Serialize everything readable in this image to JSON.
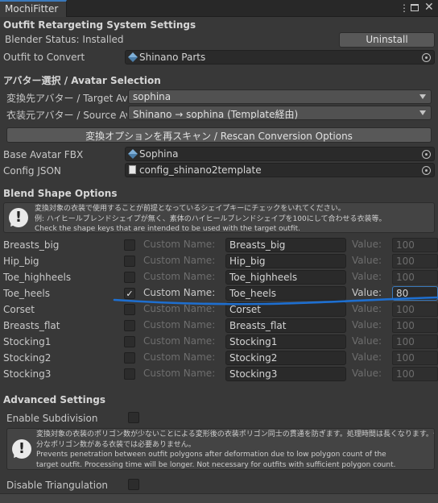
{
  "window": {
    "tab_title": "MochiFitter",
    "menu_icon": "kebab-menu-icon",
    "maximize_icon": "maximize-icon",
    "close_icon": "close-icon"
  },
  "retargeting": {
    "title": "Outfit Retargeting System Settings",
    "blender_status": "Blender Status: Installed",
    "uninstall_label": "Uninstall",
    "outfit_label": "Outfit to Convert",
    "outfit_value": "Shinano Parts"
  },
  "avatar": {
    "title": "アバター選択 / Avatar Selection",
    "target_label": "変換先アバター / Target Avat",
    "target_value": "sophina",
    "source_label": "衣装元アバター / Source Ava",
    "source_value": "Shinano → sophina (Template経由)",
    "rescan_label": "変換オプションを再スキャン / Rescan Conversion Options",
    "base_fbx_label": "Base Avatar FBX",
    "base_fbx_value": "Sophina",
    "config_label": "Config JSON",
    "config_value": "config_shinano2template"
  },
  "blend": {
    "title": "Blend Shape Options",
    "help_lines": [
      "変換対象の衣装で使用することが前提となっているシェイプキーにチェックをいれてください。",
      "例: ハイヒールブレンドシェイプが無く、素体のハイヒールブレンドシェイプを100にして合わせる衣装等。",
      "Check the shape keys that are intended to be used with the target outfit."
    ],
    "custom_name_label": "Custom Name:",
    "value_label": "Value:",
    "rows": [
      {
        "name": "Breasts_big",
        "checked": false,
        "custom": "Breasts_big",
        "value": "100"
      },
      {
        "name": "Hip_big",
        "checked": false,
        "custom": "Hip_big",
        "value": "100"
      },
      {
        "name": "Toe_highheels",
        "checked": false,
        "custom": "Toe_highheels",
        "value": "100"
      },
      {
        "name": "Toe_heels",
        "checked": true,
        "custom": "Toe_heels",
        "value": "80"
      },
      {
        "name": "Corset",
        "checked": false,
        "custom": "Corset",
        "value": "100"
      },
      {
        "name": "Breasts_flat",
        "checked": false,
        "custom": "Breasts_flat",
        "value": "100"
      },
      {
        "name": "Stocking1",
        "checked": false,
        "custom": "Stocking1",
        "value": "100"
      },
      {
        "name": "Stocking2",
        "checked": false,
        "custom": "Stocking2",
        "value": "100"
      },
      {
        "name": "Stocking3",
        "checked": false,
        "custom": "Stocking3",
        "value": "100"
      }
    ],
    "check_glyph": "✓"
  },
  "advanced": {
    "title": "Advanced Settings",
    "subdivision_label": "Enable Subdivision",
    "subdivision_help": [
      "変換対象の衣装のポリゴン数が少ないことによる変形後の衣装ポリゴン同士の貫通を防ぎます。処理時間は長くなります。十",
      "分なポリゴン数がある衣装では必要ありません。",
      "Prevents penetration between outfit polygons after deformation due to low polygon count of the",
      "target outfit. Processing time will be longer. Not necessary for outfits with sufficient polygon count."
    ],
    "triangulation_label": "Disable Triangulation"
  },
  "colors": {
    "accent": "#3a79bb",
    "annotation": "#1e6fd0",
    "background": "#383838"
  }
}
